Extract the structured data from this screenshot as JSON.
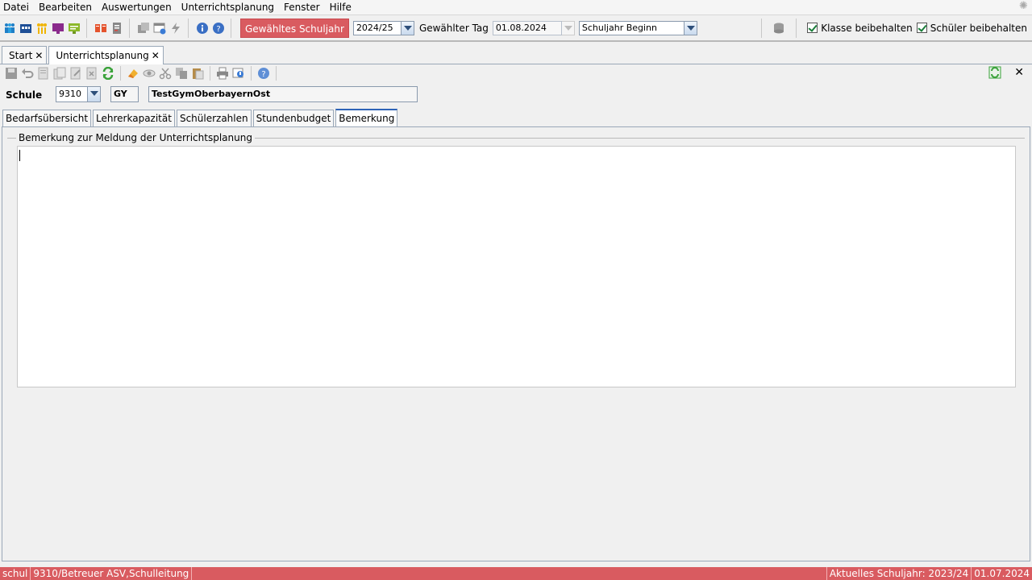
{
  "menu": {
    "items": [
      {
        "label": "Datei"
      },
      {
        "label": "Bearbeiten"
      },
      {
        "label": "Auswertungen"
      },
      {
        "label": "Unterrichtsplanung"
      },
      {
        "label": "Fenster"
      },
      {
        "label": "Hilfe"
      }
    ]
  },
  "toolbar": {
    "year_button": "Gewähltes Schuljahr",
    "year_value": "2024/25",
    "day_label": "Gewählter Tag",
    "day_value": "01.08.2024",
    "period_value": "Schuljahr Beginn",
    "keep_class": "Klasse beibehalten",
    "keep_student": "Schüler beibehalten"
  },
  "doc_tabs": [
    {
      "label": "Start"
    },
    {
      "label": "Unterrichtsplanung"
    }
  ],
  "school": {
    "label": "Schule",
    "number": "9310",
    "type": "GY",
    "name": "TestGymOberbayernOst"
  },
  "content_tabs": [
    {
      "label": "Bedarfsübersicht"
    },
    {
      "label": "Lehrerkapazität"
    },
    {
      "label": "Schülerzahlen"
    },
    {
      "label": "Stundenbudget"
    },
    {
      "label": "Bemerkung"
    }
  ],
  "panel": {
    "title": "Bemerkung zur Meldung der Unterrichtsplanung",
    "text": ""
  },
  "status": {
    "user": "schul",
    "role": "9310/Betreuer ASV,Schulleitung",
    "current_year": "Aktuelles Schuljahr: 2023/24",
    "date": "01.07.2024"
  },
  "colors": {
    "accent_red": "#d95b60",
    "tab_active": "#2e63b8"
  }
}
